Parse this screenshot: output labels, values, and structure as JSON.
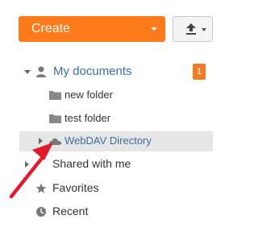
{
  "toolbar": {
    "create_label": "Create",
    "upload_icon": "upload-icon",
    "accent_color": "#ff7a1a"
  },
  "tree": {
    "my_documents": {
      "label": "My documents",
      "badge": "1",
      "children": [
        {
          "label": "new folder",
          "icon": "folder-icon"
        },
        {
          "label": "test folder",
          "icon": "folder-icon"
        },
        {
          "label": "WebDAV Directory",
          "icon": "cloud-icon",
          "selected": true
        }
      ]
    },
    "shared_with_me": {
      "label": "Shared with me"
    },
    "favorites": {
      "label": "Favorites",
      "icon": "star-icon"
    },
    "recent": {
      "label": "Recent",
      "icon": "clock-icon"
    }
  },
  "annotation": {
    "arrow_color": "#e21b2c"
  }
}
